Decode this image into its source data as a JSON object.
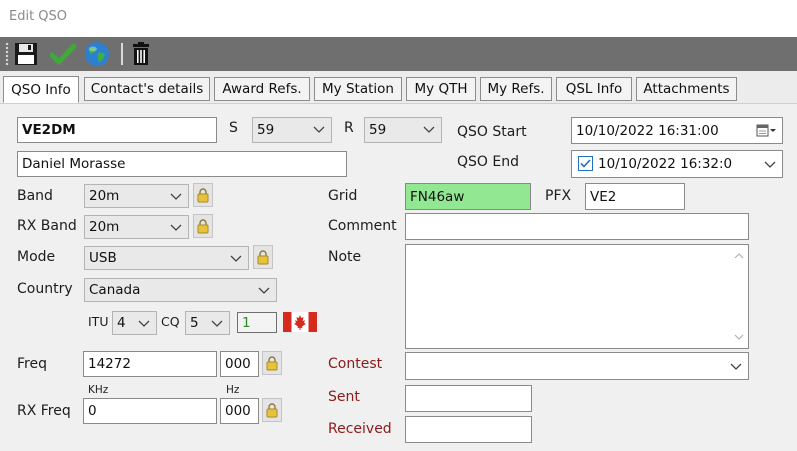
{
  "window": {
    "title": "Edit QSO"
  },
  "toolbar": {
    "icons": [
      "save-icon",
      "checkmark-icon",
      "globe-icon",
      "trash-icon"
    ]
  },
  "tabs": [
    {
      "label": "QSO Info",
      "active": true
    },
    {
      "label": "Contact's details"
    },
    {
      "label": "Award Refs."
    },
    {
      "label": "My Station"
    },
    {
      "label": "My QTH"
    },
    {
      "label": "My Refs."
    },
    {
      "label": "QSL Info"
    },
    {
      "label": "Attachments"
    }
  ],
  "form": {
    "callsign": "VE2DM",
    "name": "Daniel Morasse",
    "s_label": "S",
    "s_value": "59",
    "r_label": "R",
    "r_value": "59",
    "qso_start_label": "QSO Start",
    "qso_start_value": "10/10/2022 16:31:00",
    "qso_end_label": "QSO End",
    "qso_end_checked": true,
    "qso_end_value": "10/10/2022 16:32:0",
    "band_label": "Band",
    "band_value": "20m",
    "rx_band_label": "RX Band",
    "rx_band_value": "20m",
    "mode_label": "Mode",
    "mode_value": "USB",
    "country_label": "Country",
    "country_value": "Canada",
    "itu_label": "ITU",
    "itu_value": "4",
    "cq_label": "CQ",
    "cq_value": "5",
    "count_value": "1",
    "grid_label": "Grid",
    "grid_value": "FN46aw",
    "pfx_label": "PFX",
    "pfx_value": "VE2",
    "comment_label": "Comment",
    "comment_value": "",
    "note_label": "Note",
    "note_value": "",
    "freq_label": "Freq",
    "freq_value": "14272",
    "freq_hz_value": "000",
    "khz_label": "KHz",
    "hz_label": "Hz",
    "rx_freq_label": "RX Freq",
    "rx_freq_value": "0",
    "rx_freq_hz_value": "000",
    "contest_label": "Contest",
    "contest_value": "",
    "sent_label": "Sent",
    "sent_value": "",
    "received_label": "Received",
    "received_value": ""
  },
  "colors": {
    "toolbar_bg": "#6f6f6f",
    "grid_bg": "#92e892",
    "contest_label": "#8b1a1a",
    "lock": "#e8c33a"
  }
}
